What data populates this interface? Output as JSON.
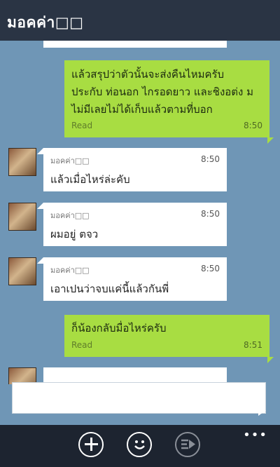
{
  "header": {
    "title": "มอคค่า□□"
  },
  "messages": [
    {
      "direction": "out",
      "text": "แล้วสรุปว่าตัวนั้นจะส่งคืนไหมครับ\nประกับ ท่อนอก ไกรอดยาว และชิงอต่ง ม\nไม่มีเลยไม่ได้เก็บแล้วตามที่บอก",
      "status": "Read",
      "time": "8:50"
    },
    {
      "direction": "in",
      "sender": "มอคค่า□□",
      "text": "แล้วเมื่อไหร่ล่ะคับ",
      "time": "8:50"
    },
    {
      "direction": "in",
      "sender": "มอคค่า□□",
      "text": "ผมอยู่ ตจว",
      "time": "8:50"
    },
    {
      "direction": "in",
      "sender": "มอคค่า□□",
      "text": "เอาเปนว่าจบแค่นี้แล้วกันพี่",
      "time": "8:50"
    },
    {
      "direction": "out",
      "text": "ก็น้องกลับมื่อไหร่ครับ",
      "status": "Read",
      "time": "8:51"
    }
  ],
  "compose": {
    "placeholder": ""
  },
  "appbar": {
    "more": "•••"
  },
  "colors": {
    "background": "#6f96b6",
    "outgoing": "#a8dd42",
    "incoming": "#ffffff",
    "header": "#2a3444"
  }
}
